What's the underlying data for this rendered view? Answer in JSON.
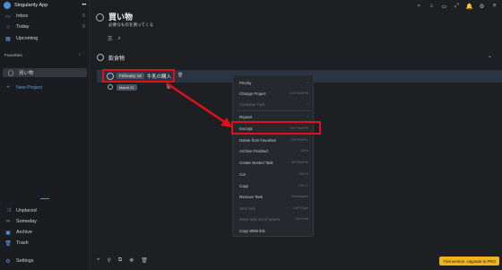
{
  "app": {
    "name": "Singularity App",
    "menu_glyph": "•••"
  },
  "sidebar": {
    "items": [
      {
        "label": "Inbox",
        "icon": "inbox-icon",
        "glyph": "▭",
        "count": "0"
      },
      {
        "label": "Today",
        "icon": "star-icon",
        "glyph": "☆",
        "count": "0"
      },
      {
        "label": "Upcoming",
        "icon": "calendar-icon",
        "glyph": "▦",
        "count": ""
      }
    ],
    "favorites_label": "Favorites",
    "favorites_chevron": "‹",
    "favorite_project": "買い物",
    "new_project": "New Project",
    "bottom_items": [
      {
        "label": "Unplaced",
        "icon": "shuffle-icon",
        "glyph": "⤨"
      },
      {
        "label": "Someday",
        "icon": "infinity-icon",
        "glyph": "∞"
      },
      {
        "label": "Archive",
        "icon": "archive-icon",
        "glyph": "▣"
      },
      {
        "label": "Trash",
        "icon": "trash-icon",
        "glyph": "🗑"
      }
    ],
    "settings": "Settings"
  },
  "topbar": {
    "icons": [
      {
        "name": "search-icon",
        "glyph": "⌕"
      },
      {
        "name": "tag-icon",
        "glyph": "⌂"
      },
      {
        "name": "inbox-tray-icon",
        "glyph": "▭"
      },
      {
        "name": "expand-icon",
        "glyph": "⤢"
      },
      {
        "name": "bell-icon",
        "glyph": "🔔"
      },
      {
        "name": "settings-icon",
        "glyph": "⚙"
      },
      {
        "name": "list-icon",
        "glyph": "≡"
      }
    ]
  },
  "project": {
    "title": "買い物",
    "subtitle": "必要なものを買ってくる",
    "toolbar_glyphs": {
      "list": "☰",
      "search": "⌕"
    },
    "section": "飲食物",
    "section_chevron": "⌄"
  },
  "tasks": [
    {
      "date": "February 18",
      "text": "牛乳の購入",
      "trash_glyph": "🗑"
    },
    {
      "date": "March 21",
      "text": "",
      "trash_glyph": "🗑"
    }
  ],
  "context_menu": {
    "items": [
      {
        "label": "Priority",
        "shortcut": "›",
        "dim": false
      },
      {
        "label": "Change Project",
        "shortcut": "Ctrl+Shift+M",
        "dim": false
      },
      {
        "label": "Complete Task",
        "shortcut": "›",
        "dim": true
      },
      {
        "label": "Repeat",
        "shortcut": "›",
        "dim": false
      },
      {
        "label": "Encrypt",
        "shortcut": "Ctrl+Shift+E",
        "dim": false
      },
      {
        "label": "Delete from Favorites",
        "shortcut": "Ctrl+Shift+L",
        "dim": false
      },
      {
        "label": "Archive Finished",
        "shortcut": "Alt+a",
        "dim": false
      },
      {
        "label": "Create Nested Task",
        "shortcut": "Alt+Shift+N",
        "dim": false
      },
      {
        "label": "Cut",
        "shortcut": "Ctrl+X",
        "dim": false
      },
      {
        "label": "Copy",
        "shortcut": "Ctrl+C",
        "dim": false
      },
      {
        "label": "Remove Task",
        "shortcut": "Backspace",
        "dim": false
      },
      {
        "label": "Nest task",
        "shortcut": "Ctrl+Right",
        "dim": true
      },
      {
        "label": "Move task out of parent",
        "shortcut": "Ctrl+Left",
        "dim": true
      },
      {
        "label": "Copy WEB link",
        "shortcut": "",
        "dim": false
      }
    ]
  },
  "bottom_bar": {
    "icons": [
      {
        "name": "add-icon",
        "glyph": "+"
      },
      {
        "name": "pin-icon",
        "glyph": "⚲"
      },
      {
        "name": "copy-icon",
        "glyph": "⧉"
      },
      {
        "name": "move-icon",
        "glyph": "✥"
      },
      {
        "name": "trash-icon",
        "glyph": "🗑"
      }
    ],
    "trial": "Trial version. Upgrade to PRO"
  },
  "colors": {
    "accent": "#4a8fd8",
    "highlight": "#e0101a",
    "trial": "#f0b51e"
  }
}
